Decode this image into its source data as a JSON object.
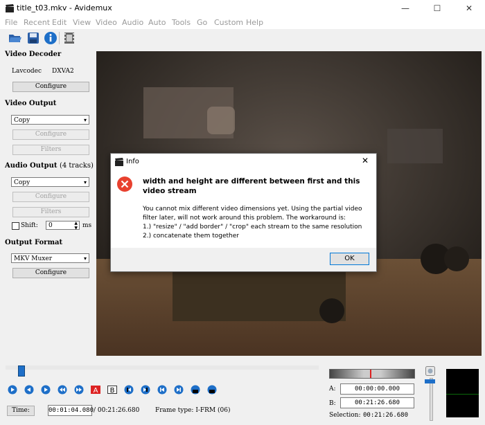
{
  "window": {
    "title": "title_t03.mkv - Avidemux"
  },
  "menu": [
    "File",
    "Recent",
    "Edit",
    "View",
    "Video",
    "Audio",
    "Auto",
    "Tools",
    "Go",
    "Custom",
    "Help"
  ],
  "panel": {
    "video_decoder": {
      "heading": "Video Decoder",
      "codec": "Lavcodec",
      "codec_value": "DXVA2",
      "configure": "Configure"
    },
    "video_output": {
      "heading": "Video Output",
      "selected": "Copy",
      "configure": "Configure",
      "filters": "Filters"
    },
    "audio_output": {
      "heading": "Audio Output",
      "tracks": "(4 tracks)",
      "selected": "Copy",
      "configure": "Configure",
      "filters": "Filters",
      "shift_label": "Shift:",
      "shift_value": "0",
      "shift_unit": "ms"
    },
    "output_format": {
      "heading": "Output Format",
      "selected": "MKV Muxer",
      "configure": "Configure"
    }
  },
  "dialog": {
    "title": "Info",
    "heading": "width and height are different between first and this video stream",
    "body_1": "You cannot mix different video dimensions yet. Using the partial video",
    "body_2": "filter later, will not work around this problem. The workaround is:",
    "body_3": "1.) \"resize\" / \"add border\" / \"crop\" each stream to the same resolution",
    "body_4": "2.) concatenate them together",
    "ok": "OK"
  },
  "player": {
    "time_label": "Time:",
    "time_value": "00:01:04.080",
    "duration": "/ 00:21:26.680",
    "frame_type": "Frame type: I-FRM (06)",
    "seek_fraction": 0.05
  },
  "selection": {
    "a_label": "A:",
    "a_value": "00:00:00.000",
    "b_label": "B:",
    "b_value": "00:21:26.680",
    "sel_label": "Selection:",
    "sel_value": "00:21:26.680"
  },
  "colors": {
    "accent": "#1e6fc8",
    "error": "#e8412f",
    "video_bg": "#2a241f"
  }
}
